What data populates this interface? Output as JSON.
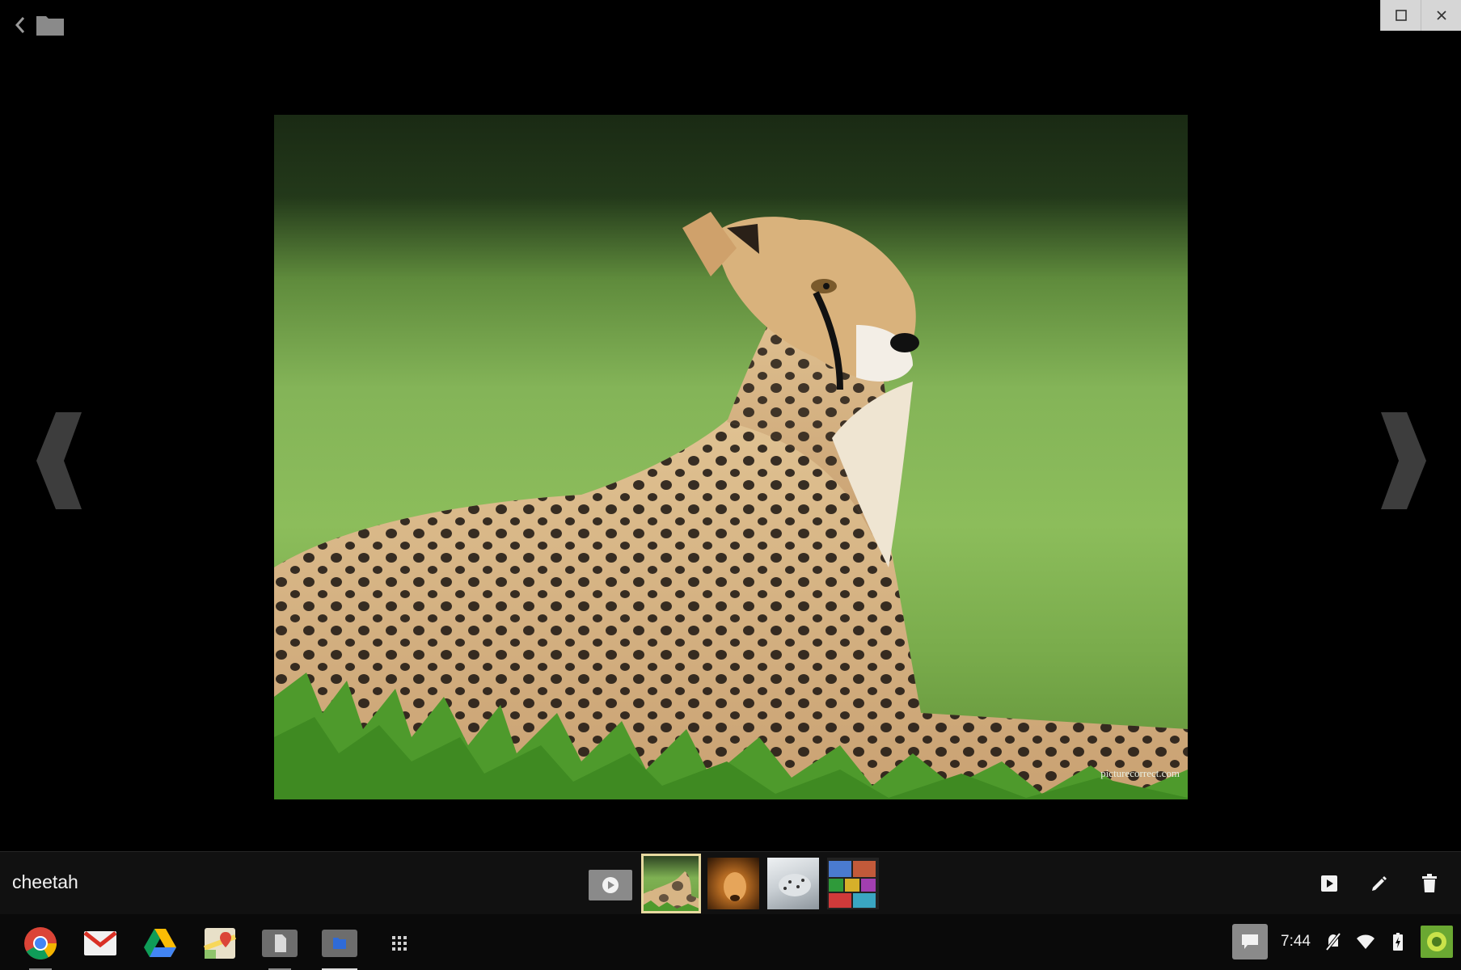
{
  "viewer": {
    "file_name": "cheetah",
    "watermark": "picturecorrect.com",
    "thumbnails": [
      {
        "name": "cheetah",
        "active": true
      },
      {
        "name": "lion",
        "active": false
      },
      {
        "name": "snow-leopard",
        "active": false
      },
      {
        "name": "collage",
        "active": false
      }
    ]
  },
  "icons": {
    "back": "chevron-left-icon",
    "folder": "folder-icon",
    "maximize": "maximize-icon",
    "close": "close-icon",
    "prev": "previous-image-icon",
    "next": "next-image-icon",
    "slideshow": "slideshow-icon",
    "share": "play-icon",
    "edit": "pencil-icon",
    "delete": "trash-icon"
  },
  "shelf": {
    "apps": [
      "Chrome",
      "Gmail",
      "Google Drive",
      "Google Maps",
      "Docs",
      "Files",
      "App launcher"
    ],
    "clock": "7:44"
  },
  "colors": {
    "ribbon": "#111111",
    "thumb_highlight": "#e8d9a0",
    "window_controls": "#d6d6d6"
  }
}
